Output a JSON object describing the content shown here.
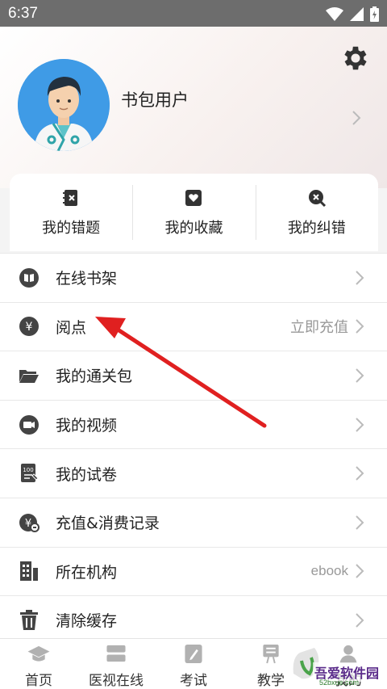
{
  "status_bar": {
    "time": "6:37"
  },
  "profile": {
    "username": "书包用户"
  },
  "quick_actions": [
    {
      "label": "我的错题",
      "icon": "notebook-x-icon"
    },
    {
      "label": "我的收藏",
      "icon": "heart-icon"
    },
    {
      "label": "我的纠错",
      "icon": "search-x-icon"
    }
  ],
  "menu": [
    {
      "label": "在线书架",
      "icon": "book-icon",
      "value": ""
    },
    {
      "label": "阅点",
      "icon": "yen-coin-icon",
      "value": "立即充值"
    },
    {
      "label": "我的通关包",
      "icon": "folder-icon",
      "value": ""
    },
    {
      "label": "我的视频",
      "icon": "video-camera-icon",
      "value": ""
    },
    {
      "label": "我的试卷",
      "icon": "exam-paper-icon",
      "value": ""
    },
    {
      "label": "充值&消费记录",
      "icon": "recharge-icon",
      "value": ""
    },
    {
      "label": "所在机构",
      "icon": "building-icon",
      "value": "ebook"
    },
    {
      "label": "清除缓存",
      "icon": "trash-icon",
      "value": ""
    }
  ],
  "bottom_nav": [
    {
      "label": "首页",
      "icon": "graduation-cap-icon"
    },
    {
      "label": "医视在线",
      "icon": "stack-icon"
    },
    {
      "label": "考试",
      "icon": "pencil-icon"
    },
    {
      "label": "教学",
      "icon": "teaching-icon"
    },
    {
      "label": "我的",
      "icon": "user-icon"
    }
  ],
  "watermark": {
    "text": "吾爱软件园",
    "url": "52bxue.com"
  },
  "colors": {
    "annotation_arrow": "#e02020",
    "avatar_bg": "#3f9be6",
    "status_bar_bg": "#6d6d6d"
  }
}
